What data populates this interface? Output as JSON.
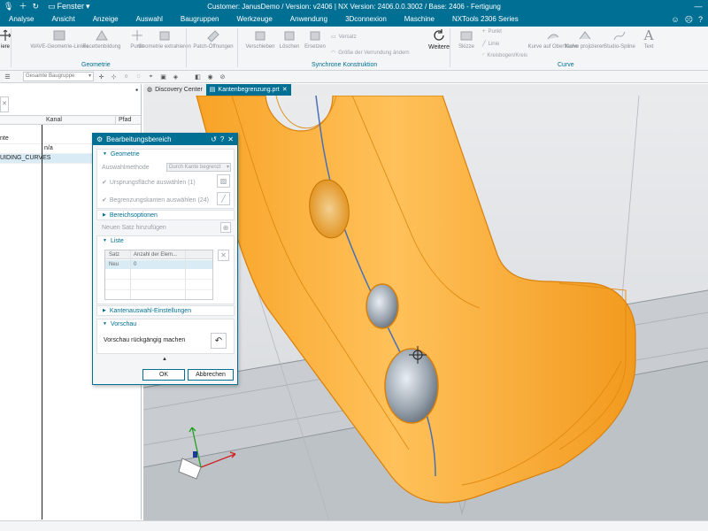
{
  "titlebar": {
    "window_menu": "Fenster",
    "title": "Customer: JanusDemo / Version: v2406 | NX Version: 2406.0.0.3002 / Base: 2406 - Fertigung"
  },
  "menu": {
    "tabs": [
      "Analyse",
      "Ansicht",
      "Anzeige",
      "Auswahl",
      "Baugruppen",
      "Werkzeuge",
      "Anwendung",
      "3Dconnexion",
      "Maschine",
      "NXTools 2306 Series"
    ]
  },
  "ribbon": {
    "left_partial": "iere",
    "items": {
      "wave": "WAVE-Geometrie-Linker",
      "facet": "Facettenbildung",
      "point": "Punkt",
      "extract": "Geometrie extrahieren",
      "patch": "Patch-Öffnungen",
      "move": "Verschieben",
      "delete": "Löschen",
      "replace": "Ersetzen",
      "offset": "Versatz",
      "resize_blend": "Größe der Verrundung ändern",
      "more": "Weitere",
      "sketch": "Skizze",
      "point2": "Punkt",
      "line": "Linie",
      "arc": "Kreisbogen/Kreis",
      "curve_on_surface": "Kurve auf Oberfläche",
      "project_curve": "Kurve projizieren",
      "studio_spline": "Studio-Spline",
      "text": "Text"
    },
    "groups": {
      "geometry": "Geometrie",
      "sync": "Synchrone Konstruktion",
      "curve": "Curve"
    }
  },
  "toolbar": {
    "filter_value": "Gesamte Baugruppe"
  },
  "navigator": {
    "columns": [
      "Kanal",
      "Pfad"
    ],
    "rows": [
      {
        "name": "nte",
        "kanal": "",
        "selected": false
      },
      {
        "name": "",
        "kanal": "n/a",
        "selected": false
      },
      {
        "name": "UIDING_CURVES",
        "kanal": "",
        "selected": true
      }
    ]
  },
  "graphics_tabs": {
    "discovery": "Discovery Center",
    "part": "Kantenbegrenzung.prt"
  },
  "dialog": {
    "title": "Bearbeitungsbereich",
    "geometry_section": "Geometrie",
    "selection_method_label": "Auswahlmethode",
    "selection_method_value": "Durch Kante begrenzt",
    "source_face": "Ursprungsfläche auswählen (1)",
    "boundary_edges": "Begrenzungskanten auswählen (24)",
    "region_options": "Bereichsoptionen",
    "new_set": "Neuen Satz hinzufügen",
    "list_section": "Liste",
    "list_columns": [
      "Satz",
      "Anzahl der Elem..."
    ],
    "list_rows": [
      {
        "set": "Neu",
        "count": "0"
      }
    ],
    "edge_selection_settings": "Kantenauswahl-Einstellungen",
    "preview_section": "Vorschau",
    "undo_preview": "Vorschau rückgängig machen",
    "ok": "OK",
    "cancel": "Abbrechen"
  },
  "colors": {
    "accent": "#006f94",
    "part": "#f5a623",
    "selection": "#4a6fb5"
  }
}
